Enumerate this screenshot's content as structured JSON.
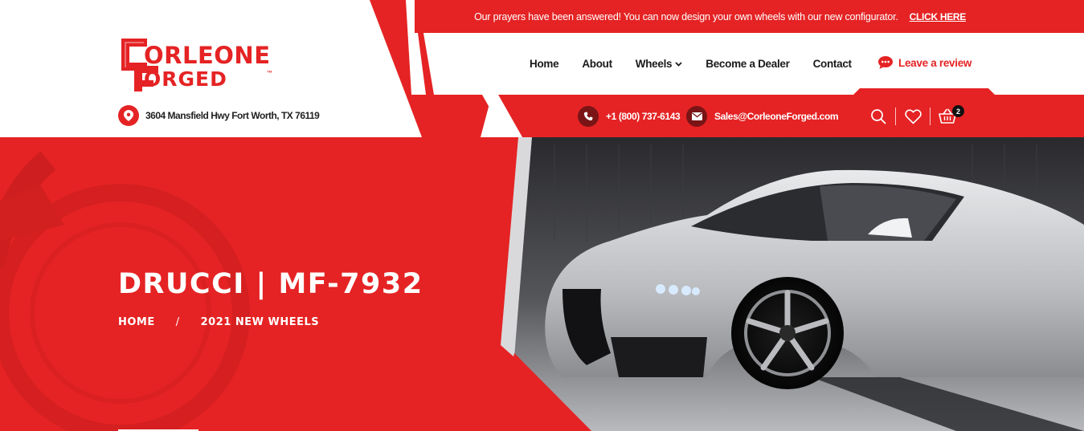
{
  "topbar": {
    "message": "Our prayers have been answered! You can now design your own wheels with our new configurator.",
    "cta": "CLICK HERE"
  },
  "logo": {
    "line1": "ORLEONE",
    "line2": "ORGED",
    "tm": "™",
    "alt_text": "CORLEONE FORGED"
  },
  "address": "3604 Mansfield Hwy Fort Worth, TX 76119",
  "nav": {
    "items": [
      {
        "label": "Home"
      },
      {
        "label": "About"
      },
      {
        "label": "Wheels"
      },
      {
        "label": "Become a Dealer"
      },
      {
        "label": "Contact"
      }
    ],
    "review": "Leave a review"
  },
  "contact": {
    "phone": "+1 (800) 737-6143",
    "email": "Sales@CorleoneForged.com"
  },
  "cart": {
    "count": "2"
  },
  "hero": {
    "title": "DRUCCI | MF-7932",
    "breadcrumb": [
      "HOME",
      "2021 NEW WHEELS"
    ],
    "separator": "/"
  },
  "colors": {
    "brand_red": "#e52324",
    "dark_red": "#7a1416",
    "text_dark": "#1a1a1a"
  },
  "icons": [
    "map-pin-icon",
    "chat-bubble-icon",
    "chevron-down-icon",
    "phone-icon",
    "mail-icon",
    "search-icon",
    "heart-icon",
    "cart-icon"
  ]
}
